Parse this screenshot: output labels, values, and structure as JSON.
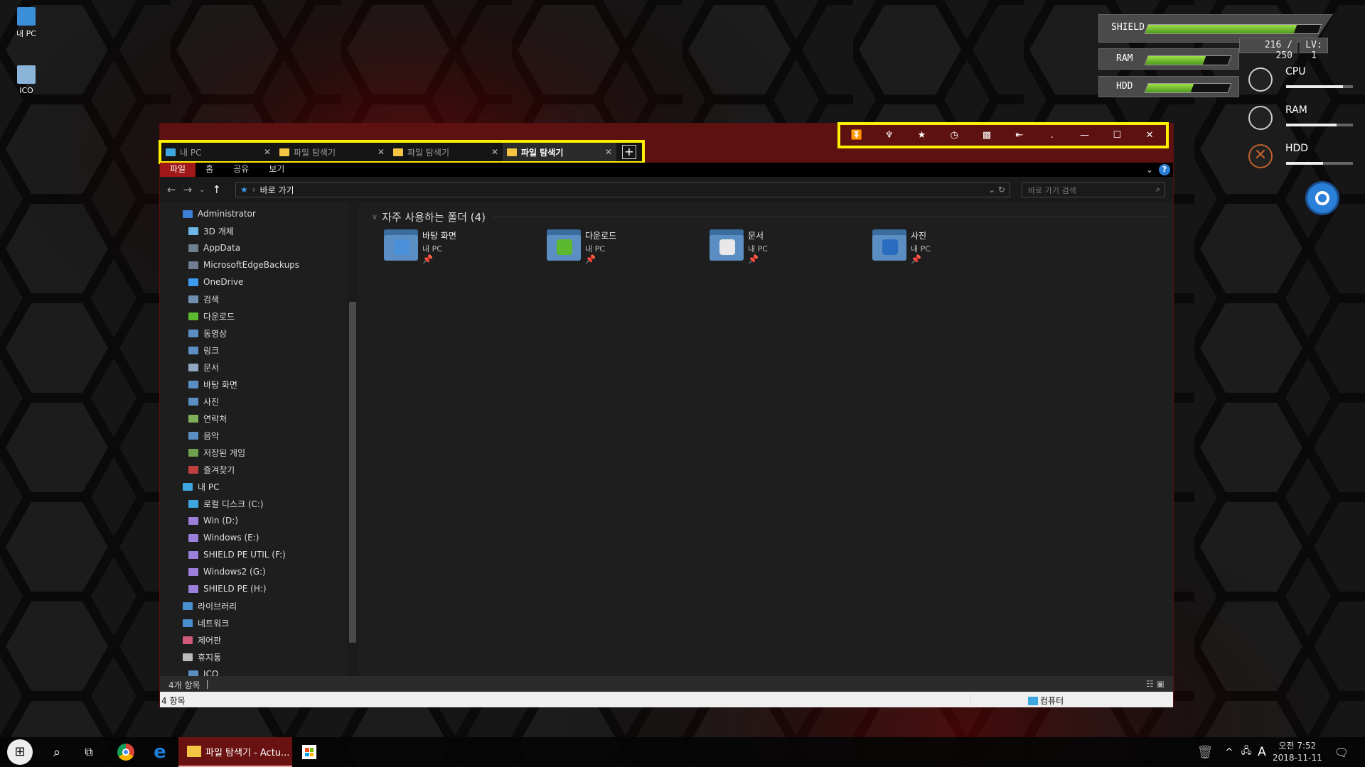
{
  "desktop": {
    "icons": [
      {
        "label": "내 PC"
      },
      {
        "label": "ICO"
      }
    ]
  },
  "explorer": {
    "tabs": [
      {
        "label": "내 PC",
        "icon": "pc-icon"
      },
      {
        "label": "파일 탐색기",
        "icon": "folder-icon"
      },
      {
        "label": "파일 탐색기",
        "icon": "folder-icon"
      },
      {
        "label": "파일 탐색기",
        "icon": "folder-icon",
        "active": true
      }
    ],
    "new_tab": "+",
    "title_controls": [
      "⏬",
      "♆",
      "★",
      "◷",
      "▩",
      "⇤",
      ".",
      "—",
      "☐",
      "✕"
    ],
    "ribbon_tabs": [
      "파일",
      "홈",
      "공유",
      "보기"
    ],
    "help": "?",
    "address": {
      "location": "바로 가기",
      "search_placeholder": "바로 가기 검색"
    },
    "sidebar": [
      {
        "label": "Administrator",
        "level": 0,
        "color": "#3d7fd6"
      },
      {
        "label": "3D 개체",
        "level": 1,
        "color": "#6fb6e8"
      },
      {
        "label": "AppData",
        "level": 1,
        "color": "#6f7f90"
      },
      {
        "label": "MicrosoftEdgeBackups",
        "level": 1,
        "color": "#6f7f90"
      },
      {
        "label": "OneDrive",
        "level": 1,
        "color": "#3d9cf0"
      },
      {
        "label": "검색",
        "level": 1,
        "color": "#6f8fb0"
      },
      {
        "label": "다운로드",
        "level": 1,
        "color": "#5cb82e"
      },
      {
        "label": "동영상",
        "level": 1,
        "color": "#5b8fc4"
      },
      {
        "label": "링크",
        "level": 1,
        "color": "#5b8fc4"
      },
      {
        "label": "문서",
        "level": 1,
        "color": "#8fa8c0"
      },
      {
        "label": "바탕 화면",
        "level": 1,
        "color": "#5b8fc4"
      },
      {
        "label": "사진",
        "level": 1,
        "color": "#5b8fc4"
      },
      {
        "label": "연락처",
        "level": 1,
        "color": "#7fae5a"
      },
      {
        "label": "음악",
        "level": 1,
        "color": "#5b8fc4"
      },
      {
        "label": "저장된 게임",
        "level": 1,
        "color": "#6fa050"
      },
      {
        "label": "즐겨찾기",
        "level": 1,
        "color": "#c04040"
      },
      {
        "label": "내 PC",
        "level": 0,
        "color": "#3fa7e0"
      },
      {
        "label": "로컬 디스크 (C:)",
        "level": 1,
        "color": "#3fa7e0"
      },
      {
        "label": "Win (D:)",
        "level": 1,
        "color": "#9b7fd8"
      },
      {
        "label": "Windows (E:)",
        "level": 1,
        "color": "#9b7fd8"
      },
      {
        "label": "SHIELD PE UTIL (F:)",
        "level": 1,
        "color": "#9b7fd8"
      },
      {
        "label": "Windows2 (G:)",
        "level": 1,
        "color": "#9b7fd8"
      },
      {
        "label": "SHIELD PE (H:)",
        "level": 1,
        "color": "#9b7fd8"
      },
      {
        "label": "라이브러리",
        "level": 0,
        "color": "#4a8fd0"
      },
      {
        "label": "네트워크",
        "level": 0,
        "color": "#4a8fd0"
      },
      {
        "label": "제어판",
        "level": 0,
        "color": "#d05a7a"
      },
      {
        "label": "휴지통",
        "level": 0,
        "color": "#bbbbbb"
      },
      {
        "label": "ICO",
        "level": 1,
        "color": "#5b8fc4"
      }
    ],
    "group_title": "자주 사용하는 폴더 (4)",
    "folders": [
      {
        "name": "바탕 화면",
        "location": "내 PC",
        "badge": "#4a90d8"
      },
      {
        "name": "다운로드",
        "location": "내 PC",
        "badge": "#5cb82e"
      },
      {
        "name": "문서",
        "location": "내 PC",
        "badge": "#e8e8e8"
      },
      {
        "name": "사진",
        "location": "내 PC",
        "badge": "#2a6cc0"
      }
    ],
    "status_count": "4개 항목",
    "status_bar2_left": "4 항목",
    "status_bar2_right": "컴퓨터"
  },
  "hud": {
    "shield_label": "SHIELD",
    "shield_level": 0.86,
    "ram_label": "RAM",
    "ram_level": 0.7,
    "hdd_label": "HDD",
    "hdd_level": 0.55,
    "shield_value": "216 / 250",
    "level_text": "LV: 1",
    "meters": [
      {
        "label": "CPU",
        "level": 0.85
      },
      {
        "label": "RAM",
        "level": 0.75
      },
      {
        "label": "HDD",
        "level": 0.55
      }
    ]
  },
  "taskbar": {
    "active_window": "파일 탐색기 - Actu...",
    "time": "오전 7:52",
    "date": "2018-11-11",
    "ime": "A"
  },
  "colors": {
    "accent_red": "#5e1111",
    "highlight_yellow": "#ffef00",
    "hud_green": "#7ccc2e"
  }
}
